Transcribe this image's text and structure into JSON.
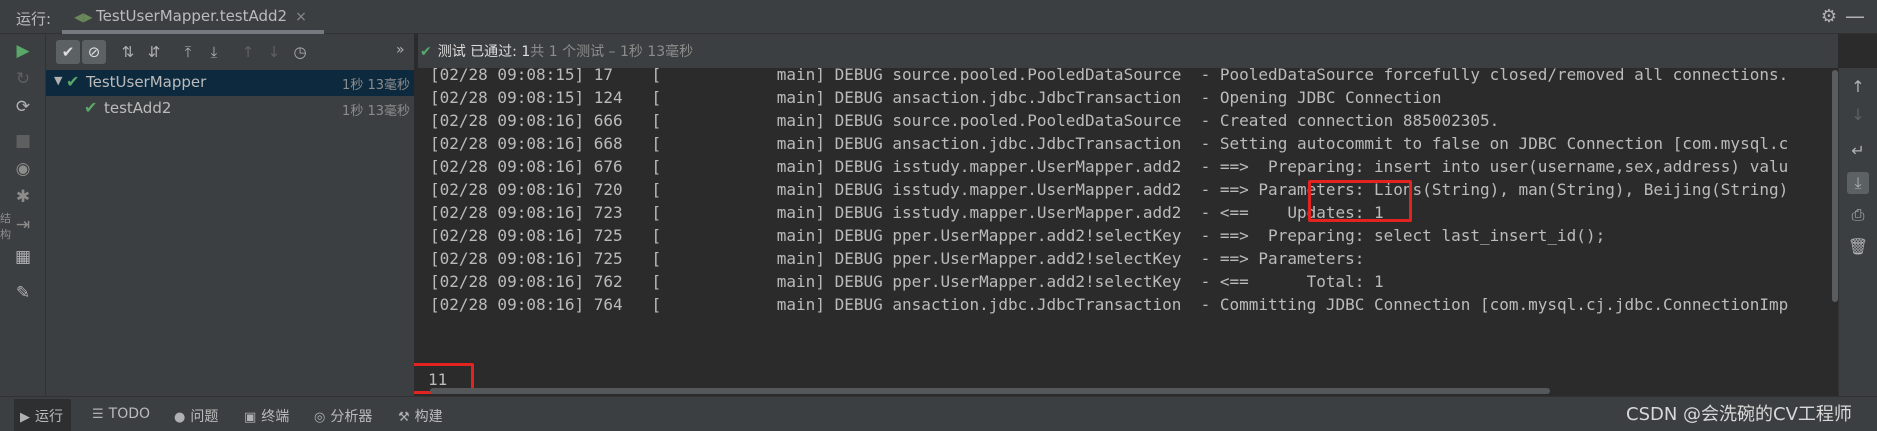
{
  "top_bar": {
    "run_label": "运行:",
    "tab_title": "TestUserMapper.testAdd2",
    "tab_close": "×",
    "settings_icon": "⚙",
    "minimize_icon": "—"
  },
  "status": {
    "check": "✔",
    "passed": "测试 已通过: 1",
    "detail": "共 1 个测试 – 1秒 13毫秒"
  },
  "tree": [
    {
      "name": "TestUserMapper",
      "time": "1秒 13毫秒",
      "expanded": true,
      "selected": true
    },
    {
      "name": "testAdd2",
      "time": "1秒 13毫秒",
      "expanded": false,
      "selected": false
    }
  ],
  "console": {
    "lines": [
      "[02/28 09:08:15] 17    [            main] DEBUG source.pooled.PooledDataSource  - PooledDataSource forcefully closed/removed all connections.",
      "[02/28 09:08:15] 124   [            main] DEBUG ansaction.jdbc.JdbcTransaction  - Opening JDBC Connection",
      "[02/28 09:08:16] 666   [            main] DEBUG source.pooled.PooledDataSource  - Created connection 885002305.",
      "[02/28 09:08:16] 668   [            main] DEBUG ansaction.jdbc.JdbcTransaction  - Setting autocommit to false on JDBC Connection [com.mysql.c",
      "[02/28 09:08:16] 676   [            main] DEBUG isstudy.mapper.UserMapper.add2  - ==>  Preparing: insert into user(username,sex,address) valu",
      "[02/28 09:08:16] 720   [            main] DEBUG isstudy.mapper.UserMapper.add2  - ==> Parameters: Lions(String), man(String), Beijing(String)",
      "[02/28 09:08:16] 723   [            main] DEBUG isstudy.mapper.UserMapper.add2  - <==    Updates: 1",
      "[02/28 09:08:16] 725   [            main] DEBUG pper.UserMapper.add2!selectKey  - ==>  Preparing: select last_insert_id();",
      "[02/28 09:08:16] 725   [            main] DEBUG pper.UserMapper.add2!selectKey  - ==> Parameters: ",
      "[02/28 09:08:16] 762   [            main] DEBUG pper.UserMapper.add2!selectKey  - <==      Total: 1",
      "[02/28 09:08:16] 764   [            main] DEBUG ansaction.jdbc.JdbcTransaction  - Committing JDBC Connection [com.mysql.cj.jdbc.ConnectionImp"
    ],
    "output": "11"
  },
  "bottom_bar": [
    {
      "icon": "▶",
      "label": "运行",
      "active": true
    },
    {
      "icon": "☰",
      "label": "TODO",
      "active": false
    },
    {
      "icon": "●",
      "label": "问题",
      "active": false
    },
    {
      "icon": "▣",
      "label": "终端",
      "active": false
    },
    {
      "icon": "◎",
      "label": "分析器",
      "active": false
    },
    {
      "icon": "⚒",
      "label": "构建",
      "active": false
    }
  ],
  "watermark": "CSDN @会洗碗的CV工程师",
  "side_text": "结构",
  "colors": {
    "pass_green": "#59a869",
    "highlight_red": "#e3231f",
    "selection_blue": "#0d293e",
    "panel_bg": "#3c3f41",
    "console_bg": "#2b2b2b"
  }
}
